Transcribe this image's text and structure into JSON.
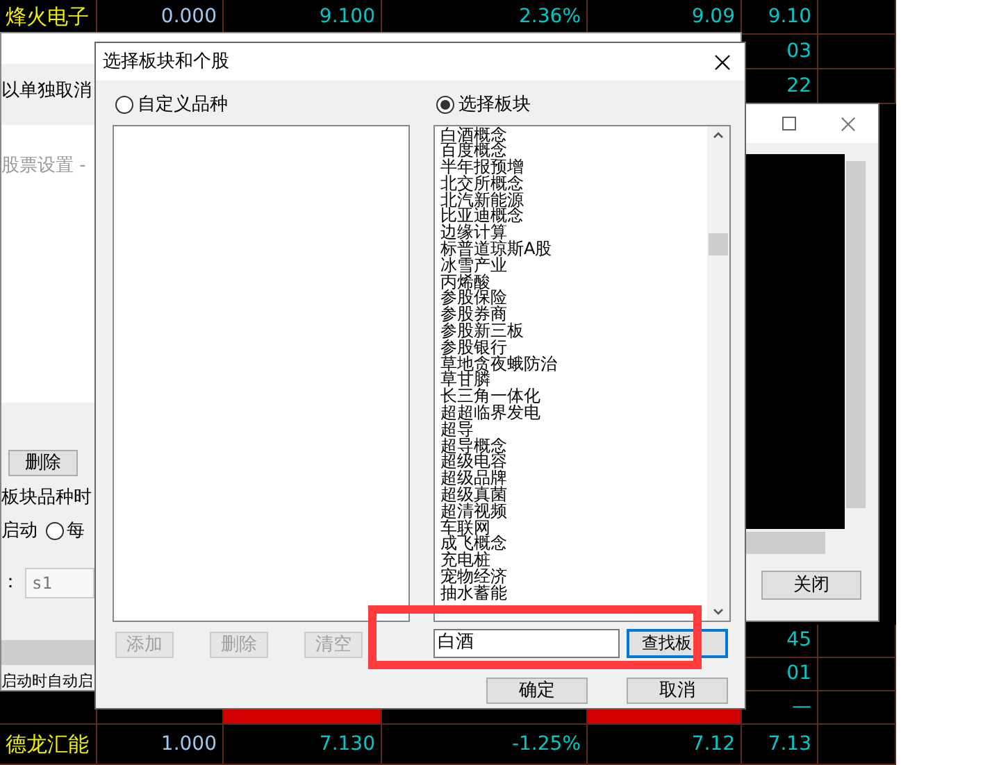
{
  "quote_grid": {
    "top_rows": [
      {
        "column_1": "烽火电子",
        "column_2": "0.000",
        "column_3": "9.100",
        "column_4": "2.36%",
        "column_5": "9.09",
        "column_6": "9.10"
      },
      {
        "column_6": "03"
      },
      {
        "column_6": "22"
      }
    ],
    "bottom_rows": [
      {
        "column_6": "45",
        "alert": false
      },
      {
        "column_6": "01",
        "alert": false
      },
      {
        "column_6": "—",
        "alert": true
      },
      {
        "column_1": "德龙汇能",
        "column_2": "1.000",
        "column_3": "7.130",
        "column_4": "-1.25%",
        "column_5": "7.12",
        "column_6": "7.13",
        "alert": false
      }
    ]
  },
  "back_window": {
    "note": "以单独取消",
    "sub_title": "股票设置 -",
    "delete_button": "删除",
    "time_label": "板块品种时",
    "start_label": "启动",
    "daily_radio": {
      "label": "每",
      "selected": false
    },
    "name_label": "：",
    "name_field": "s1",
    "autostart_label": "启动时自动启"
  },
  "right_window": {
    "close_button": "关闭"
  },
  "dialog": {
    "title": "选择板块和个股",
    "radios": [
      {
        "label": "自定义品种",
        "selected": false
      },
      {
        "label": "选择板块",
        "selected": true
      }
    ],
    "left_buttons": [
      {
        "label": "添加",
        "disabled": true
      },
      {
        "label": "删除",
        "disabled": true
      },
      {
        "label": "清空",
        "disabled": true
      }
    ],
    "sector_list": [
      "白酒概念",
      "百度概念",
      "半年报预增",
      "北交所概念",
      "北汽新能源",
      "比亚迪概念",
      "边缘计算",
      "标普道琼斯A股",
      "冰雪产业",
      "丙烯酸",
      "参股保险",
      "参股券商",
      "参股新三板",
      "参股银行",
      "草地贪夜蛾防治",
      "草甘膦",
      "长三角一体化",
      "超超临界发电",
      "超导",
      "超导概念",
      "超级电容",
      "超级品牌",
      "超级真菌",
      "超清视频",
      "车联网",
      "成飞概念",
      "充电桩",
      "宠物经济",
      "抽水蓄能"
    ],
    "search_field": "白酒",
    "search_button": "查找板",
    "ok_button": "确定",
    "cancel_button": "取消"
  },
  "annotation": {
    "kind": "rectangle"
  }
}
